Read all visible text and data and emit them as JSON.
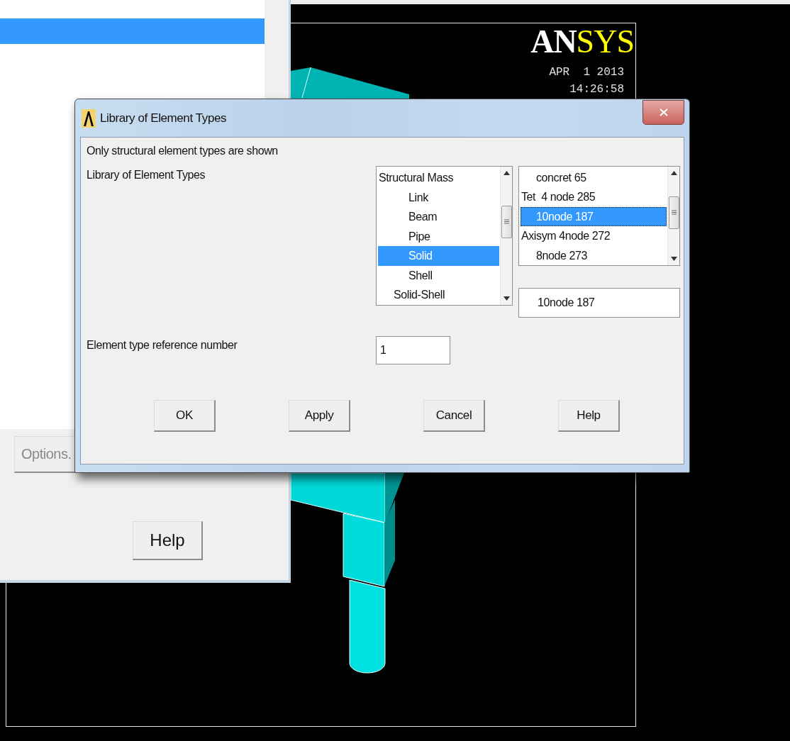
{
  "graphics": {
    "logo": [
      "AN",
      "SYS"
    ],
    "date": "APR  1 2013",
    "time": "14:26:58"
  },
  "element_types_panel": {
    "list_rows": [
      {
        "selected": true
      }
    ],
    "options_button": {
      "label": "Options.",
      "disabled": true
    },
    "help_button": {
      "label": "Help"
    }
  },
  "dialog": {
    "title": "Library of Element Types",
    "note": "Only structural element types are shown",
    "library_label": "Library of Element Types",
    "category_list": [
      {
        "label": "Structural Mass",
        "kind": "flush",
        "selected": false
      },
      {
        "label": "Link",
        "kind": "deep",
        "selected": false
      },
      {
        "label": "Beam",
        "kind": "deep",
        "selected": false
      },
      {
        "label": "Pipe",
        "kind": "deep",
        "selected": false
      },
      {
        "label": "Solid",
        "kind": "deep",
        "selected": true
      },
      {
        "label": "Shell",
        "kind": "deep",
        "selected": false
      },
      {
        "label": "Solid-Shell",
        "kind": "indent",
        "selected": false
      }
    ],
    "type_list": [
      {
        "label": "concret 65",
        "kind": "indent",
        "selected": false
      },
      {
        "label": "Tet  4 node 285",
        "kind": "flush",
        "selected": false
      },
      {
        "label": "10node 187",
        "kind": "indent",
        "selected": true
      },
      {
        "label": "Axisym 4node 272",
        "kind": "flush",
        "selected": false
      },
      {
        "label": "8node 273",
        "kind": "indent",
        "selected": false
      }
    ],
    "selection_field": {
      "value": "10node 187"
    },
    "reference_label": "Element type reference number",
    "reference_field": {
      "value": "1"
    },
    "buttons": [
      "OK",
      "Apply",
      "Cancel",
      "Help"
    ]
  }
}
